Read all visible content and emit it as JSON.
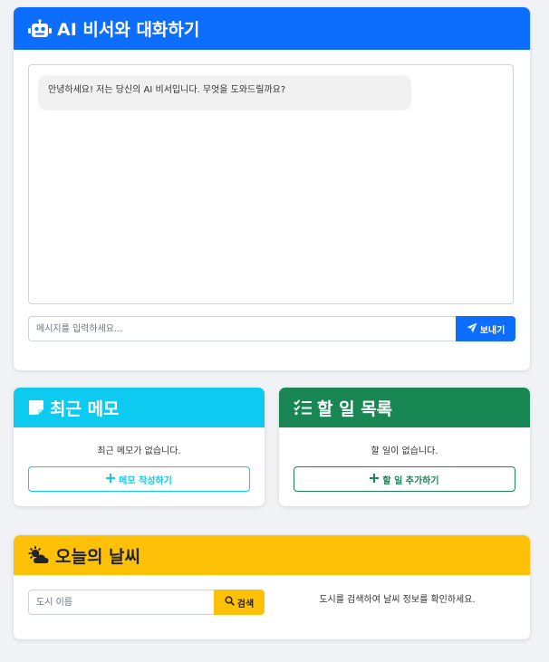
{
  "chat": {
    "title": "AI 비서와 대화하기",
    "welcome_message": "안녕하세요! 저는 당신의 AI 비서입니다. 무엇을 도와드릴까요?",
    "input_placeholder": "메시지를 입력하세요...",
    "input_value": "",
    "send_label": "보내기",
    "header_color": "#0d6efd",
    "header_icon": "robot-icon",
    "send_icon": "paper-plane-icon"
  },
  "memo": {
    "title": "최근 메모",
    "empty_text": "최근 메모가 없습니다.",
    "button_label": "메모 작성하기",
    "header_color": "#0dcaf0",
    "header_icon": "sticky-note-icon",
    "button_icon": "plus-icon"
  },
  "todo": {
    "title": "할 일 목록",
    "empty_text": "할 일이 없습니다.",
    "button_label": "할 일 추가하기",
    "header_color": "#198754",
    "header_icon": "checklist-icon",
    "button_icon": "plus-icon"
  },
  "weather": {
    "title": "오늘의 날씨",
    "city_placeholder": "도시 이름",
    "city_value": "",
    "search_label": "검색",
    "info_text": "도시를 검색하여 날씨 정보를 확인하세요.",
    "header_color": "#ffc107",
    "header_icon": "cloud-sun-icon",
    "search_icon": "magnifier-icon"
  }
}
